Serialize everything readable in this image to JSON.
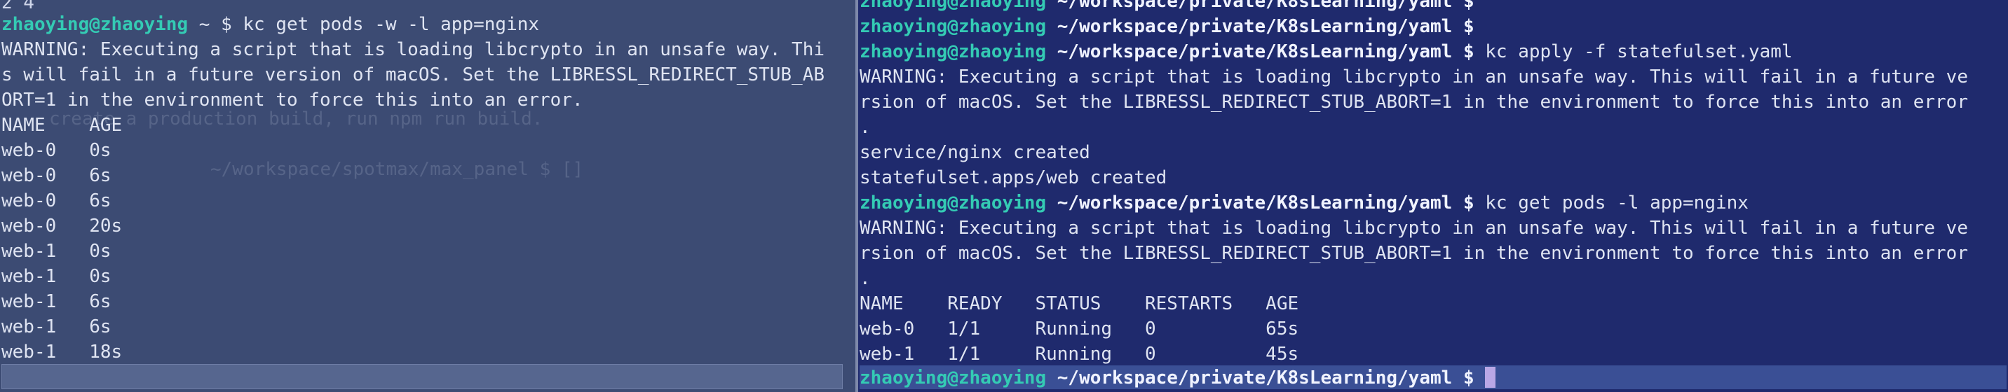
{
  "left_pane": {
    "top_partial": "2 4",
    "ghost_text": {
      "build_hint": "create a production build, run npm run build.",
      "prompt_hint": "~/workspace/spotmax/max_panel $ []"
    },
    "command": {
      "user": "zhaoying@zhaoying",
      "cwd": "~",
      "symbol": "$",
      "text": "kc get pods -w -l app=nginx"
    },
    "warning": [
      "WARNING: Executing a script that is loading libcrypto in an unsafe way. Thi",
      "s will fail in a future version of macOS. Set the LIBRESSL_REDIRECT_STUB_AB",
      "ORT=1 in the environment to force this into an error."
    ],
    "table_header": "NAME    AGE",
    "rows": [
      "web-0   0s",
      "web-0   6s",
      "web-0   6s",
      "web-0   20s",
      "web-1   0s",
      "web-1   0s",
      "web-1   6s",
      "web-1   6s",
      "web-1   18s"
    ]
  },
  "right_pane": {
    "prompt": {
      "user": "zhaoying@zhaoying",
      "cwd": "~/workspace/private/K8sLearning/yaml",
      "symbol": "$"
    },
    "line_top_partial_cmd": "",
    "line_empty_cmd": "",
    "apply_cmd": "kc apply -f statefulset.yaml",
    "warning_1": [
      "WARNING: Executing a script that is loading libcrypto in an unsafe way. This will fail in a future ve",
      "rsion of macOS. Set the LIBRESSL_REDIRECT_STUB_ABORT=1 in the environment to force this into an error",
      "."
    ],
    "service_created": "service/nginx created",
    "statefulset_created": "statefulset.apps/web created",
    "get_cmd": "kc get pods -l app=nginx",
    "warning_2": [
      "WARNING: Executing a script that is loading libcrypto in an unsafe way. This will fail in a future ve",
      "rsion of macOS. Set the LIBRESSL_REDIRECT_STUB_ABORT=1 in the environment to force this into an error",
      "."
    ],
    "table_header": "NAME    READY   STATUS    RESTARTS   AGE",
    "rows": [
      "web-0   1/1     Running   0          65s",
      "web-1   1/1     Running   0          45s"
    ]
  },
  "colors": {
    "left_bg": "#3c4b73",
    "right_bg": "#1f2a6d",
    "prompt_user": "#34cbb4",
    "cursor": "#b9a7e6"
  }
}
